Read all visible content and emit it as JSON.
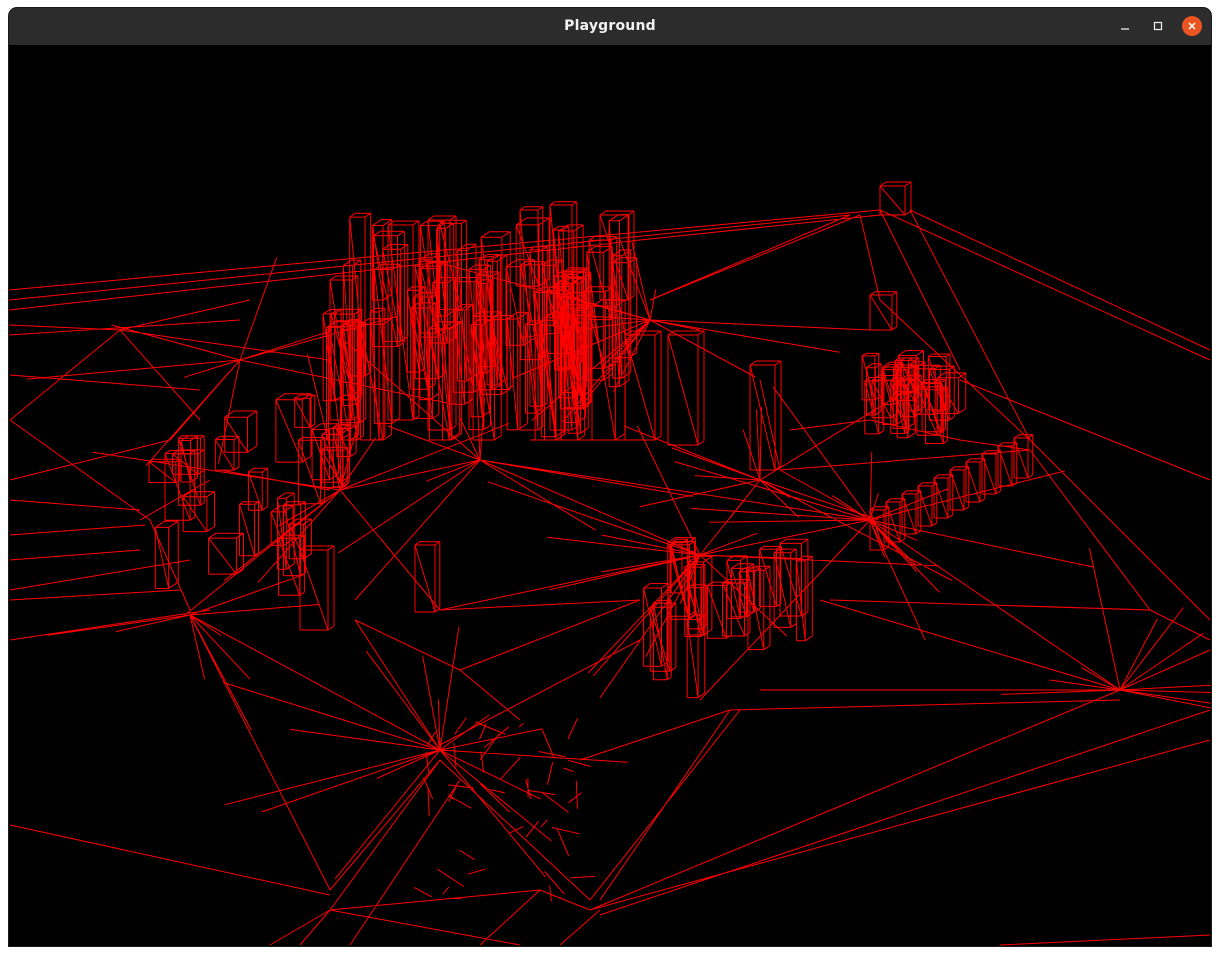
{
  "window": {
    "title": "Playground",
    "buttons": {
      "minimize": "minimize-icon",
      "maximize": "maximize-icon",
      "close": "close-icon"
    },
    "colors": {
      "titlebar": "#2c2c2c",
      "close_button": "#e95420",
      "viewport_background": "#000000",
      "wireframe": "#ff0000"
    }
  },
  "viewport": {
    "content": "wireframe-3d-scene"
  }
}
